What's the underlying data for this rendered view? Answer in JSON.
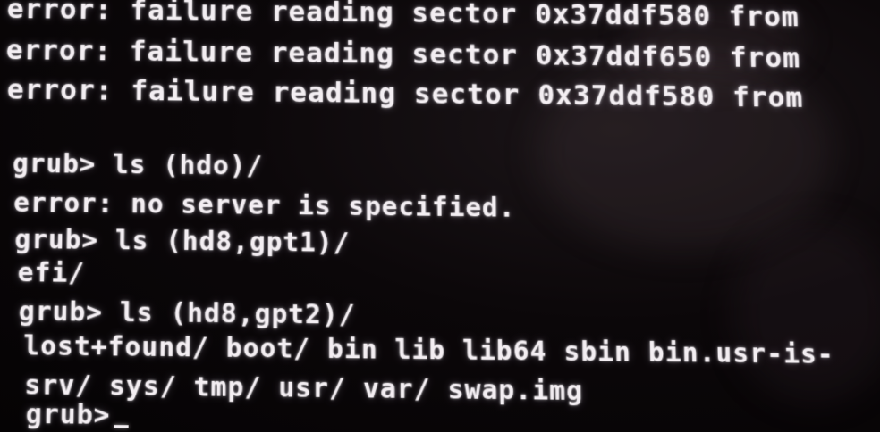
{
  "terminal": {
    "lines": [
      "error: failure reading sector 0x37ddf580 from",
      "error: failure reading sector 0x37ddf650 from",
      "error: failure reading sector 0x37ddf580 from",
      "",
      "grub> ls (hdo)/",
      "error: no server is specified.",
      "grub> ls (hd8,gpt1)/",
      "efi/",
      "grub> ls (hd8,gpt2)/",
      "lost+found/ boot/ bin lib lib64 sbin bin.usr-is-",
      "srv/ sys/ tmp/ usr/ var/ swap.img",
      "grub>"
    ]
  }
}
